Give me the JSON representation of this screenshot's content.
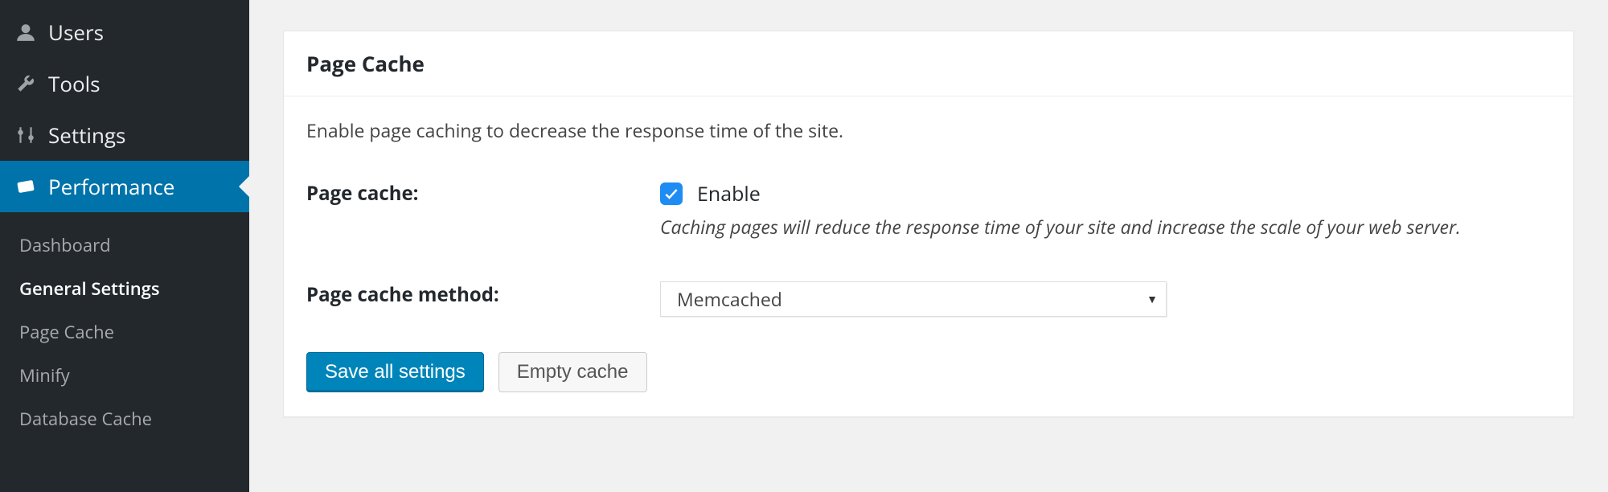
{
  "sidebar": {
    "items": [
      {
        "label": "Users"
      },
      {
        "label": "Tools"
      },
      {
        "label": "Settings"
      },
      {
        "label": "Performance"
      }
    ],
    "sub_items": [
      {
        "label": "Dashboard"
      },
      {
        "label": "General Settings"
      },
      {
        "label": "Page Cache"
      },
      {
        "label": "Minify"
      },
      {
        "label": "Database Cache"
      }
    ]
  },
  "panel": {
    "title": "Page Cache",
    "description": "Enable page caching to decrease the response time of the site.",
    "page_cache_label": "Page cache:",
    "enable_label": "Enable",
    "enable_checked": true,
    "enable_help": "Caching pages will reduce the response time of your site and increase the scale of your web server.",
    "method_label": "Page cache method:",
    "method_value": "Memcached",
    "save_label": "Save all settings",
    "empty_label": "Empty cache"
  }
}
